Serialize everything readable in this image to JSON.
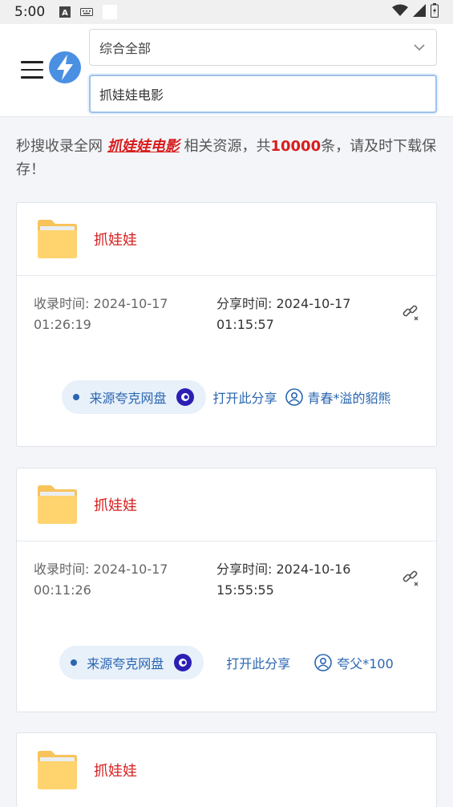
{
  "status_bar": {
    "time": "5:00",
    "icons": [
      "font-a-icon",
      "keyboard-icon",
      "wifi-icon",
      "signal-icon",
      "battery-charging-icon"
    ]
  },
  "header": {
    "menu_icon": "hamburger-menu-icon",
    "logo_icon": "lightning-bolt-logo",
    "category_select": {
      "value": "综合全部"
    },
    "search": {
      "value": "抓娃娃电影"
    }
  },
  "intro": {
    "prefix": "秒搜收录全网",
    "keyword": "抓娃娃电影",
    "middle": "相关资源，共",
    "count": "10000",
    "suffix": "条，请及时下载保存！"
  },
  "colors": {
    "accent_blue": "#2a66b0",
    "keyword_red": "#d81e1e",
    "folder_yellow": "#ffd36e"
  },
  "results": [
    {
      "title": "抓娃娃",
      "collected_label": "收录时间:",
      "collected_date": "2024-10-17",
      "collected_time": "01:26:19",
      "shared_label": "分享时间:",
      "shared_date": "2024-10-17",
      "shared_time": "01:15:57",
      "source": "来源夸克网盘",
      "open_label": "打开此分享",
      "user": "青春*溢的貂熊"
    },
    {
      "title": "抓娃娃",
      "collected_label": "收录时间:",
      "collected_date": "2024-10-17",
      "collected_time": "00:11:26",
      "shared_label": "分享时间:",
      "shared_date": "2024-10-16",
      "shared_time": "15:55:55",
      "source": "来源夸克网盘",
      "open_label": "打开此分享",
      "user": "夸父*100"
    },
    {
      "title": "抓娃娃"
    }
  ]
}
